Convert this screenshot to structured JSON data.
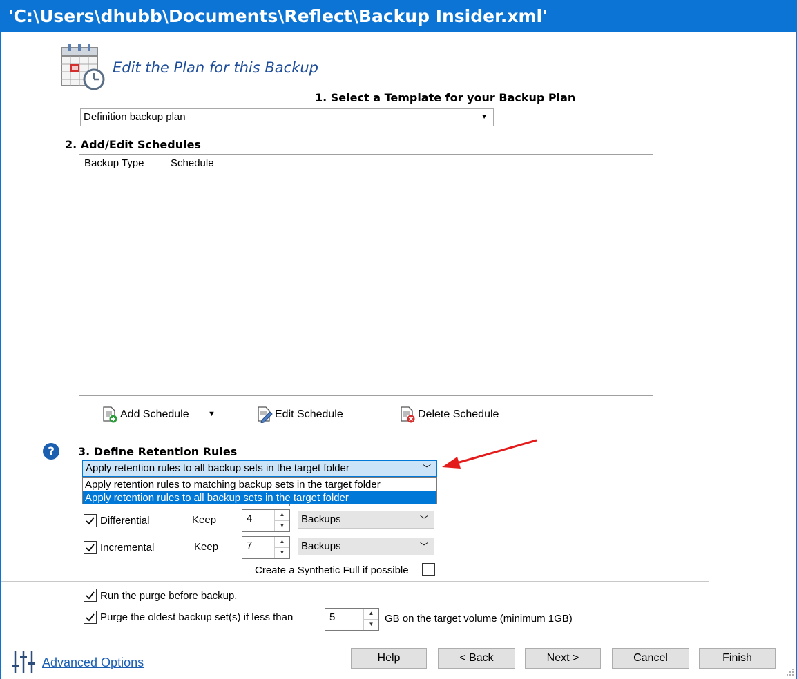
{
  "window": {
    "title": "'C:\\Users\\dhubb\\Documents\\Reflect\\Backup Insider.xml'"
  },
  "header": {
    "title": "Edit the Plan for this Backup"
  },
  "template": {
    "heading": "1. Select a Template for your Backup Plan",
    "selected": "Definition backup plan"
  },
  "schedules": {
    "heading": "2. Add/Edit Schedules",
    "columns": [
      "Backup Type",
      "Schedule"
    ],
    "add_label": "Add Schedule",
    "edit_label": "Edit Schedule",
    "delete_label": "Delete Schedule"
  },
  "retention": {
    "heading": "3. Define Retention Rules",
    "selected": "Apply retention rules to all backup sets in the target folder",
    "options": [
      "Apply retention rules to matching backup sets in the target folder",
      "Apply retention rules to all backup sets in the target folder"
    ],
    "rows": [
      {
        "label": "Differential",
        "keep_label": "Keep",
        "value": "4",
        "unit": "Backups",
        "checked": true
      },
      {
        "label": "Incremental",
        "keep_label": "Keep",
        "value": "7",
        "unit": "Backups",
        "checked": true
      }
    ],
    "synthetic_label": "Create a Synthetic Full if possible",
    "synthetic_checked": false
  },
  "purge": {
    "run_before_label": "Run the purge before backup.",
    "run_before_checked": true,
    "oldest_label": "Purge the oldest backup set(s) if less than",
    "oldest_checked": true,
    "oldest_value": "5",
    "oldest_suffix": "GB on the target volume (minimum 1GB)"
  },
  "footer": {
    "advanced_label": "Advanced Options",
    "buttons": {
      "help": "Help",
      "back": "< Back",
      "next": "Next >",
      "cancel": "Cancel",
      "finish": "Finish"
    }
  },
  "colors": {
    "titlebar": "#0b74d4",
    "selection": "#0078d7",
    "heading_blue": "#1e4e9b",
    "link": "#1a5fb4",
    "arrow": "#e31b1b"
  }
}
